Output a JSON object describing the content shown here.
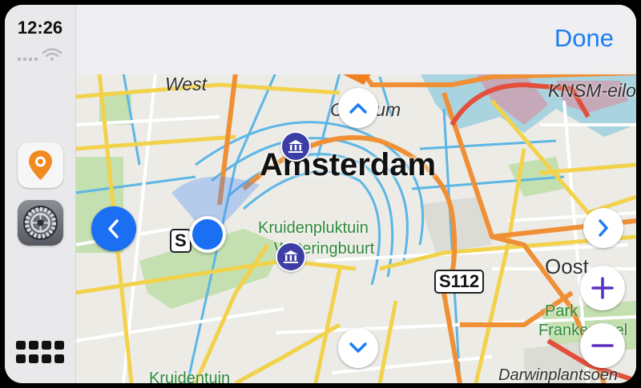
{
  "status": {
    "time": "12:26"
  },
  "sidebar": {
    "apps": [
      {
        "name": "maps-app",
        "icon": "location-pin-icon"
      },
      {
        "name": "settings-app",
        "icon": "gear-icon"
      }
    ],
    "launcher_icon": "grid-icon"
  },
  "header": {
    "done_label": "Done"
  },
  "map": {
    "city": "Amsterdam",
    "labels": {
      "west": "West",
      "centrum": "Centrum",
      "knsm": "KNSM-eilo",
      "kruidenpluktuin": "Kruidenpluktuin",
      "weteringbuurt": "Weteringbuurt",
      "oost": "Oost",
      "park": "Park",
      "frankendael": "Frankendael",
      "kruidentuin": "Kruidentuin",
      "darwin": "Darwinplantsoen"
    },
    "shields": {
      "s112": "S112",
      "s_left": "S"
    }
  },
  "controls": {
    "pan_up_icon": "chevron-up-icon",
    "pan_down_icon": "chevron-down-icon",
    "pan_left_icon": "chevron-left-icon",
    "pan_right_icon": "chevron-right-icon",
    "zoom_in_icon": "plus-icon",
    "zoom_out_icon": "minus-icon"
  },
  "colors": {
    "accent": "#1e7cf2",
    "location": "#1a6ff2",
    "zoom": "#5b2fbf",
    "poi": "#3d3ea5"
  }
}
